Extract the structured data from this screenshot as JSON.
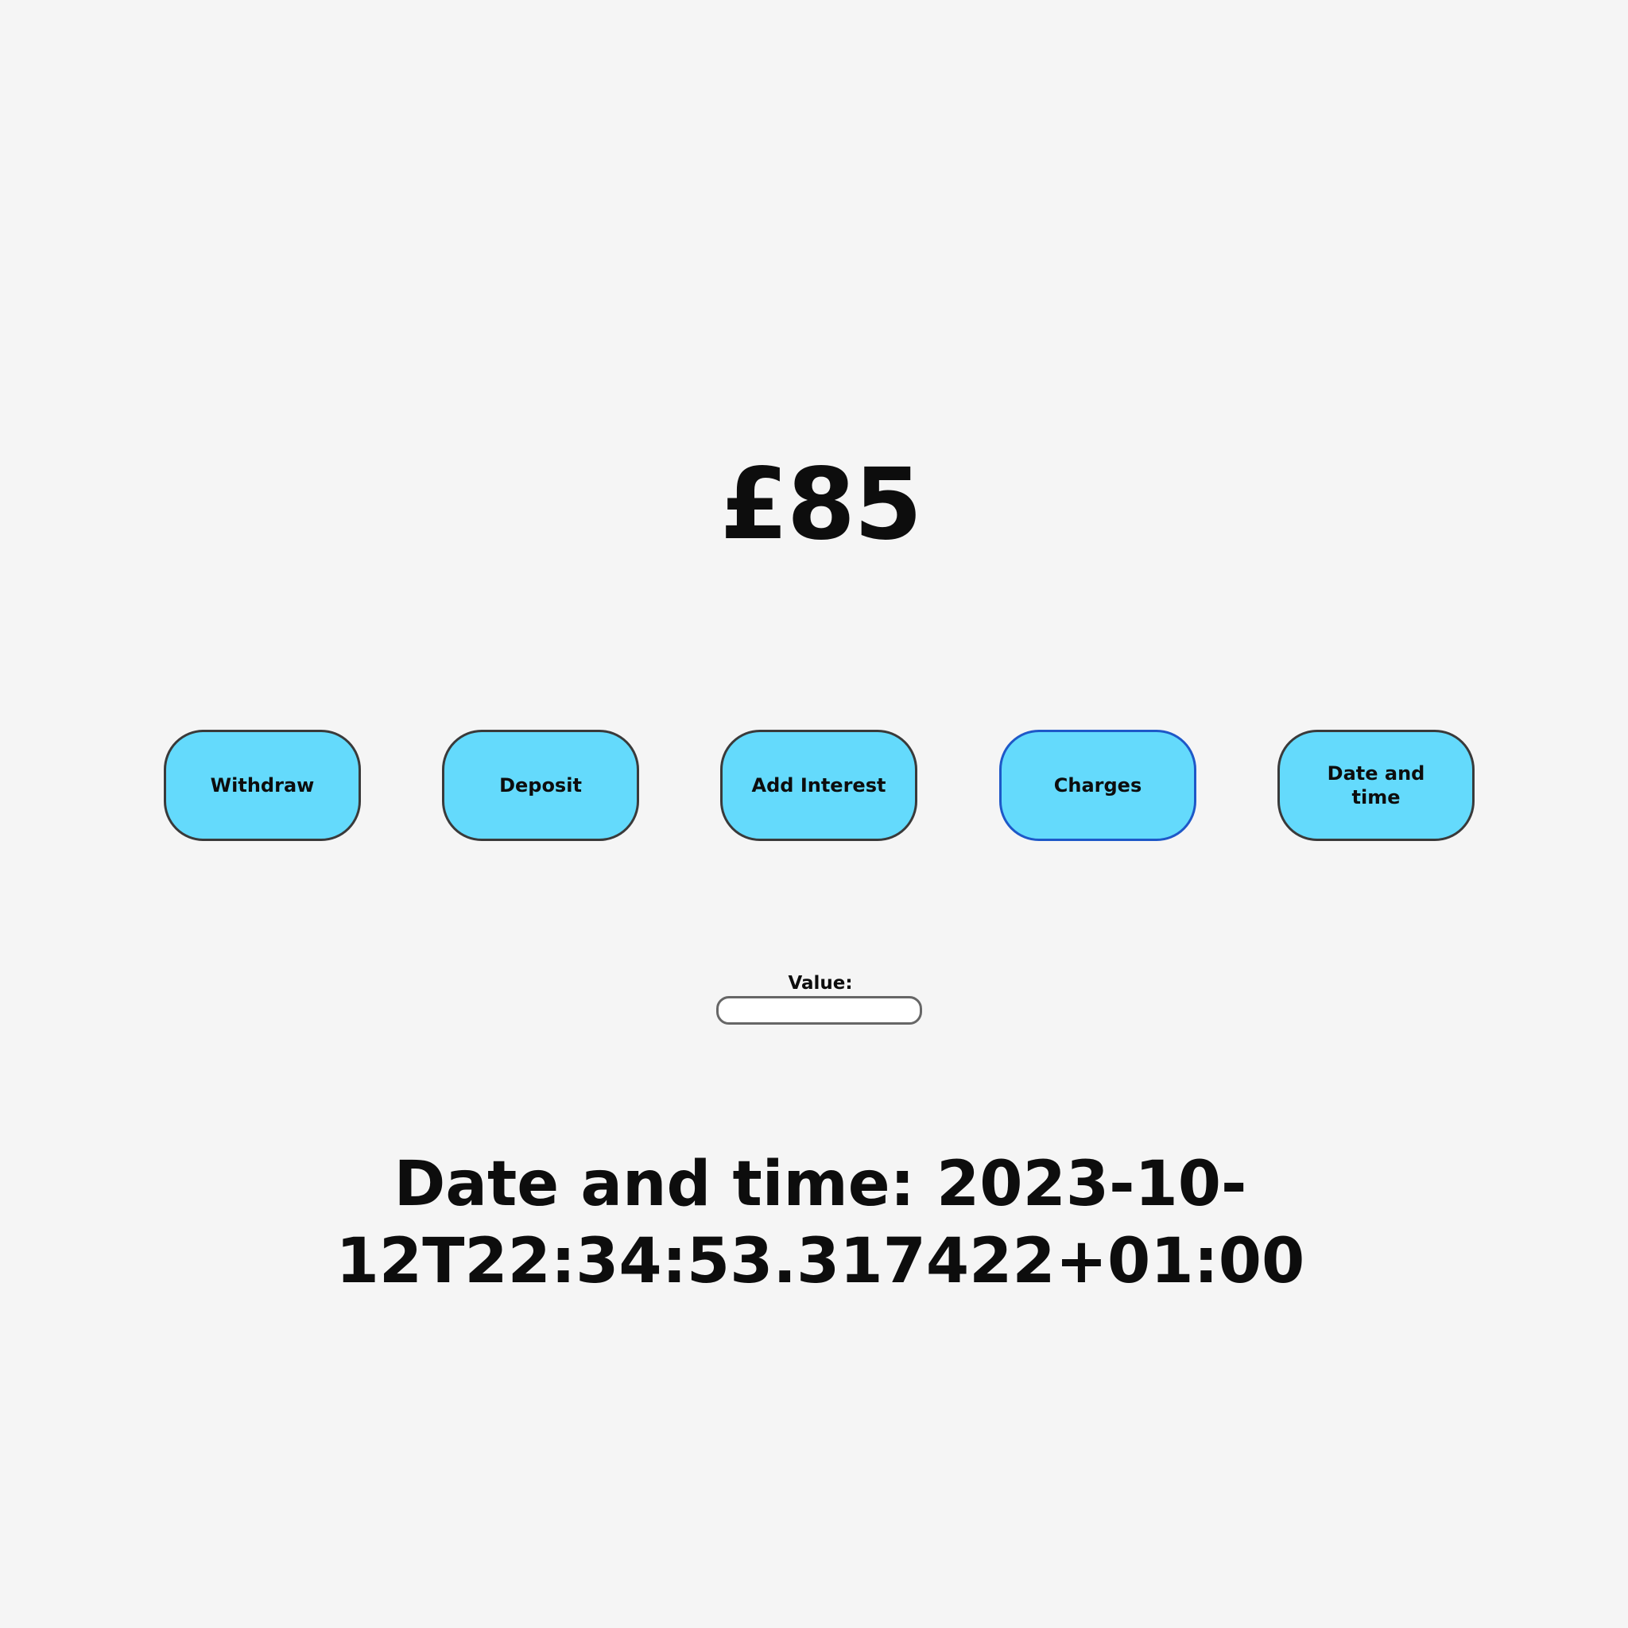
{
  "balance": {
    "amount": "£85"
  },
  "actions": {
    "withdraw_label": "Withdraw",
    "deposit_label": "Deposit",
    "add_interest_label": "Add Interest",
    "charges_label": "Charges",
    "date_time_label_line1": "Date and",
    "date_time_label_line2": "time"
  },
  "value_field": {
    "label": "Value:",
    "value": ""
  },
  "date_time_display": {
    "line1": "Date and time: 2023-10-",
    "line2": "12T22:34:53.317422+01:00"
  },
  "colors": {
    "background": "#f5f5f5",
    "button_fill": "#64dafc",
    "button_border": "#3a3a3a",
    "focused_border": "#1e58c8"
  }
}
